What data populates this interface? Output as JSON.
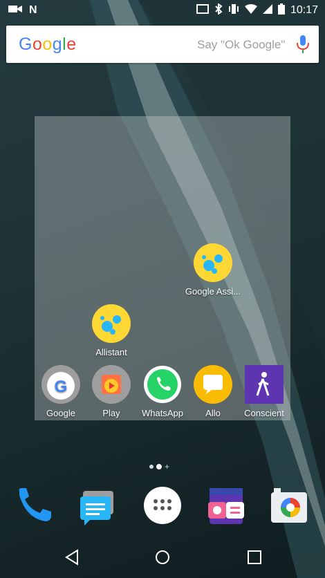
{
  "search": {
    "logo_text": "Google",
    "hint": "Say \"Ok Google\""
  },
  "status": {
    "time": "10:17"
  },
  "folder": {
    "apps": [
      {
        "label": "Google Assi..."
      },
      {
        "label": "Allistant"
      }
    ]
  },
  "row_apps": [
    {
      "label": "Google"
    },
    {
      "label": "Play"
    },
    {
      "label": "WhatsApp"
    },
    {
      "label": "Allo"
    },
    {
      "label": "Conscient"
    }
  ],
  "colors": {
    "assistant_yellow": "#fdd835",
    "assistant_blue": "#29b6f6",
    "whatsapp_green": "#25d366",
    "allo_yellow": "#fbbc05",
    "conscient_purple": "#5e35b1"
  }
}
